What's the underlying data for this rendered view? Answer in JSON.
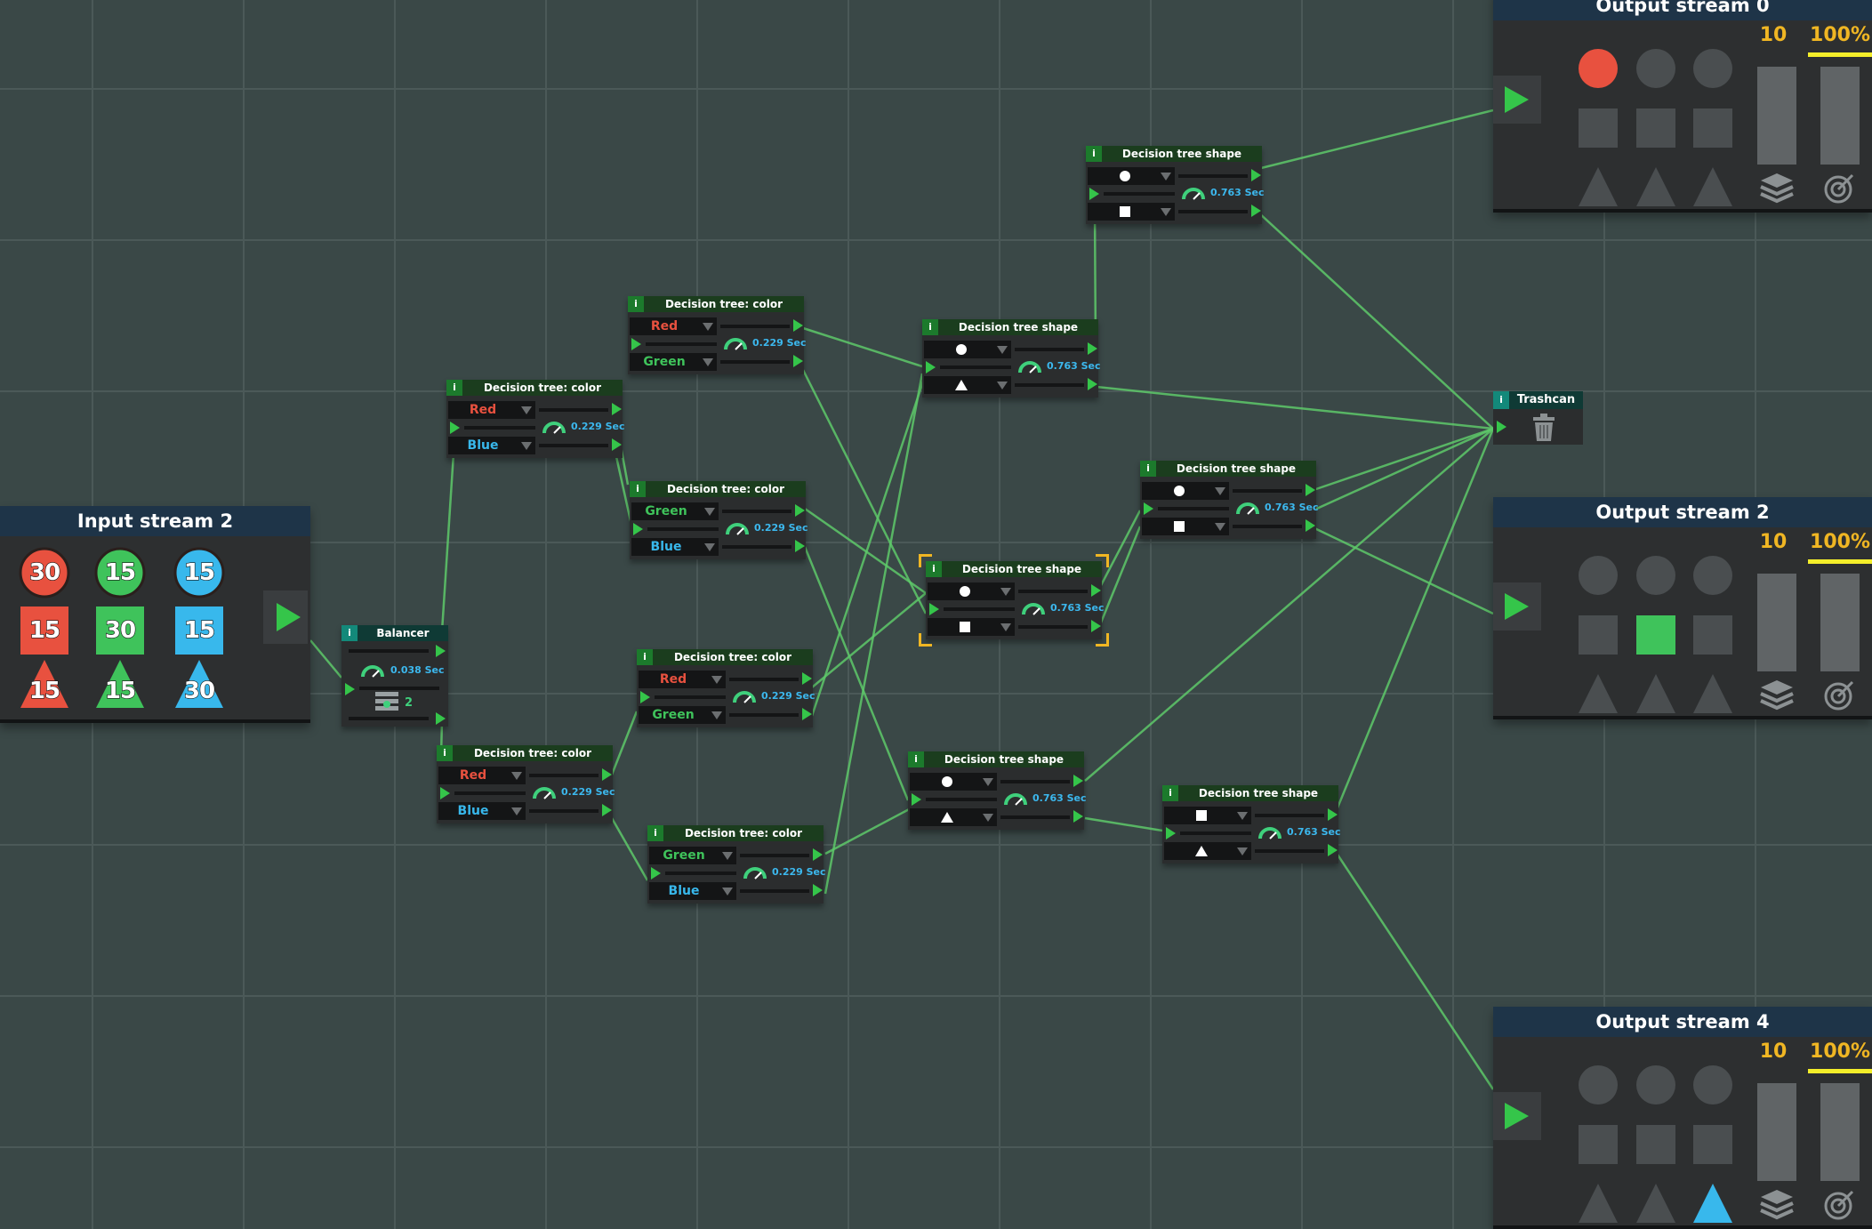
{
  "colors": {
    "red": "#e8513f",
    "green": "#3fc35b",
    "blue": "#38b8ec",
    "port": "#35c54a",
    "speed": "#3cb8ee",
    "stat": "#f0b623",
    "wire": "#5ec96a"
  },
  "input_stream": {
    "title": "Input stream 2",
    "items": [
      {
        "shape": "circle",
        "color": "red",
        "count": "30"
      },
      {
        "shape": "circle",
        "color": "green",
        "count": "15"
      },
      {
        "shape": "circle",
        "color": "blue",
        "count": "15"
      },
      {
        "shape": "square",
        "color": "red",
        "count": "15"
      },
      {
        "shape": "square",
        "color": "green",
        "count": "30"
      },
      {
        "shape": "square",
        "color": "blue",
        "count": "15"
      },
      {
        "shape": "triangle",
        "color": "red",
        "count": "15"
      },
      {
        "shape": "triangle",
        "color": "green",
        "count": "15"
      },
      {
        "shape": "triangle",
        "color": "blue",
        "count": "30"
      }
    ],
    "play_icon": "play-icon"
  },
  "output_streams": [
    {
      "title": "Output stream 0",
      "count": "10",
      "accuracy": "100%",
      "accuracy_level": 1.0,
      "count_fill": 0.9,
      "slots": [
        {
          "shape": "circle",
          "active": true,
          "color": "red"
        },
        {
          "shape": "circle",
          "active": false
        },
        {
          "shape": "circle",
          "active": false
        },
        {
          "shape": "square",
          "active": false
        },
        {
          "shape": "square",
          "active": false
        },
        {
          "shape": "square",
          "active": false
        },
        {
          "shape": "triangle",
          "active": false
        },
        {
          "shape": "triangle",
          "active": false
        },
        {
          "shape": "triangle",
          "active": false
        }
      ]
    },
    {
      "title": "Output stream 2",
      "count": "10",
      "accuracy": "100%",
      "accuracy_level": 1.0,
      "count_fill": 0.9,
      "slots": [
        {
          "shape": "circle",
          "active": false
        },
        {
          "shape": "circle",
          "active": false
        },
        {
          "shape": "circle",
          "active": false
        },
        {
          "shape": "square",
          "active": false
        },
        {
          "shape": "square",
          "active": true,
          "color": "green"
        },
        {
          "shape": "square",
          "active": false
        },
        {
          "shape": "triangle",
          "active": false
        },
        {
          "shape": "triangle",
          "active": false
        },
        {
          "shape": "triangle",
          "active": false
        }
      ]
    },
    {
      "title": "Output stream 4",
      "count": "10",
      "accuracy": "100%",
      "accuracy_level": 1.0,
      "count_fill": 0.9,
      "slots": [
        {
          "shape": "circle",
          "active": false
        },
        {
          "shape": "circle",
          "active": false
        },
        {
          "shape": "circle",
          "active": false
        },
        {
          "shape": "square",
          "active": false
        },
        {
          "shape": "square",
          "active": false
        },
        {
          "shape": "square",
          "active": false
        },
        {
          "shape": "triangle",
          "active": false
        },
        {
          "shape": "triangle",
          "active": false
        },
        {
          "shape": "triangle",
          "active": true,
          "color": "blue"
        }
      ]
    }
  ],
  "balancer": {
    "info": "i",
    "title": "Balancer",
    "speed": "0.038 Sec",
    "outputs": "2"
  },
  "trashcan": {
    "info": "i",
    "title": "Trashcan"
  },
  "nodes": [
    {
      "id": "c1",
      "info": "i",
      "title": "Decision tree: color",
      "type": "color",
      "top": {
        "label": "Red",
        "color": "red"
      },
      "bottom": {
        "label": "Blue",
        "color": "blue"
      },
      "speed": "0.229 Sec"
    },
    {
      "id": "c2",
      "info": "i",
      "title": "Decision tree: color",
      "type": "color",
      "top": {
        "label": "Red",
        "color": "red"
      },
      "bottom": {
        "label": "Green",
        "color": "green"
      },
      "speed": "0.229 Sec"
    },
    {
      "id": "c3",
      "info": "i",
      "title": "Decision tree: color",
      "type": "color",
      "top": {
        "label": "Green",
        "color": "green"
      },
      "bottom": {
        "label": "Blue",
        "color": "blue"
      },
      "speed": "0.229 Sec"
    },
    {
      "id": "c4",
      "info": "i",
      "title": "Decision tree: color",
      "type": "color",
      "top": {
        "label": "Red",
        "color": "red"
      },
      "bottom": {
        "label": "Green",
        "color": "green"
      },
      "speed": "0.229 Sec"
    },
    {
      "id": "c5",
      "info": "i",
      "title": "Decision tree: color",
      "type": "color",
      "top": {
        "label": "Red",
        "color": "red"
      },
      "bottom": {
        "label": "Blue",
        "color": "blue"
      },
      "speed": "0.229 Sec"
    },
    {
      "id": "c6",
      "info": "i",
      "title": "Decision tree: color",
      "type": "color",
      "top": {
        "label": "Green",
        "color": "green"
      },
      "bottom": {
        "label": "Blue",
        "color": "blue"
      },
      "speed": "0.229 Sec"
    },
    {
      "id": "s1",
      "info": "i",
      "title": "Decision tree shape",
      "type": "shape",
      "top": {
        "shape": "circle"
      },
      "bottom": {
        "shape": "square"
      },
      "speed": "0.763 Sec"
    },
    {
      "id": "s2",
      "info": "i",
      "title": "Decision tree shape",
      "type": "shape",
      "top": {
        "shape": "circle"
      },
      "bottom": {
        "shape": "triangle"
      },
      "speed": "0.763 Sec"
    },
    {
      "id": "s3",
      "info": "i",
      "title": "Decision tree shape",
      "type": "shape",
      "top": {
        "shape": "circle"
      },
      "bottom": {
        "shape": "square"
      },
      "speed": "0.763 Sec"
    },
    {
      "id": "s4",
      "info": "i",
      "title": "Decision tree shape",
      "type": "shape",
      "top": {
        "shape": "circle"
      },
      "bottom": {
        "shape": "square"
      },
      "speed": "0.763 Sec",
      "selected": true
    },
    {
      "id": "s5",
      "info": "i",
      "title": "Decision tree shape",
      "type": "shape",
      "top": {
        "shape": "circle"
      },
      "bottom": {
        "shape": "triangle"
      },
      "speed": "0.763 Sec"
    },
    {
      "id": "s6",
      "info": "i",
      "title": "Decision tree shape",
      "type": "shape",
      "top": {
        "shape": "square"
      },
      "bottom": {
        "shape": "triangle"
      },
      "speed": "0.763 Sec"
    }
  ]
}
